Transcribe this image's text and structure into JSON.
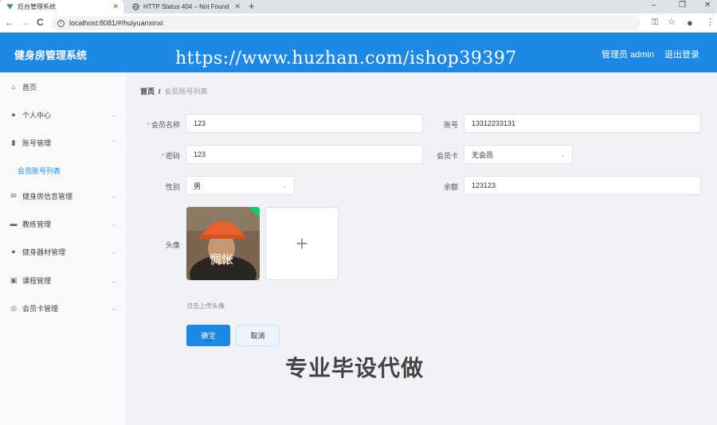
{
  "browser": {
    "tabs": [
      {
        "title": "后台管理系统",
        "active": true
      },
      {
        "title": "HTTP Status 404 – Not Found",
        "active": false
      }
    ],
    "new_tab_label": "+",
    "url": "localhost:8081/#/huiyuanxinxi",
    "window_controls": [
      "–",
      "❐",
      "✕"
    ],
    "nav": {
      "back": "←",
      "forward": "→",
      "reload": "C"
    },
    "right_icons": {
      "key": "⚿",
      "star": "☆",
      "profile": "●",
      "menu": "⋮"
    }
  },
  "header": {
    "title": "健身房管理系统",
    "watermark": "https://www.huzhan.com/ishop39397",
    "admin_label": "管理员 admin",
    "logout_label": "退出登录",
    "accent_color": "#1e88e5"
  },
  "sidebar": {
    "items": [
      {
        "label": "首页",
        "icon": "home-icon",
        "glyph": "⌂",
        "expandable": false
      },
      {
        "label": "个人中心",
        "icon": "user-icon",
        "glyph": "●",
        "expandable": true
      },
      {
        "label": "账号管理",
        "icon": "account-icon",
        "glyph": "▮",
        "expandable": true,
        "expanded": true
      },
      {
        "label": "健身房信息管理",
        "icon": "mail-icon",
        "glyph": "✉",
        "expandable": true
      },
      {
        "label": "教练管理",
        "icon": "briefcase-icon",
        "glyph": "▬",
        "expandable": true
      },
      {
        "label": "健身器材管理",
        "icon": "user-icon",
        "glyph": "●",
        "expandable": true
      },
      {
        "label": "课程管理",
        "icon": "calendar-icon",
        "glyph": "▣",
        "expandable": true
      },
      {
        "label": "会员卡管理",
        "icon": "compass-icon",
        "glyph": "◎",
        "expandable": true
      }
    ],
    "submenu_label": "会员账号列表",
    "chev_down": "⌄",
    "chev_up": "⌃"
  },
  "breadcrumb": {
    "home": "首页",
    "separator": "/",
    "current": "会员账号列表"
  },
  "form": {
    "name_label": "会员名称",
    "name_value": "123",
    "account_label": "账号",
    "account_value": "13312233131",
    "password_label": "密码",
    "password_value": "123",
    "card_label": "会员卡",
    "card_value": "无会员",
    "gender_label": "性别",
    "gender_value": "男",
    "balance_label": "余额",
    "balance_value": "123123",
    "avatar_label": "头像",
    "avatar_caption": "惆怅",
    "upload_plus": "+",
    "upload_hint": "点击上传头像",
    "submit_label": "确定",
    "cancel_label": "取消",
    "required_mark": "*",
    "select_arrow": "⌄"
  },
  "overlay_text": "专业毕设代做"
}
